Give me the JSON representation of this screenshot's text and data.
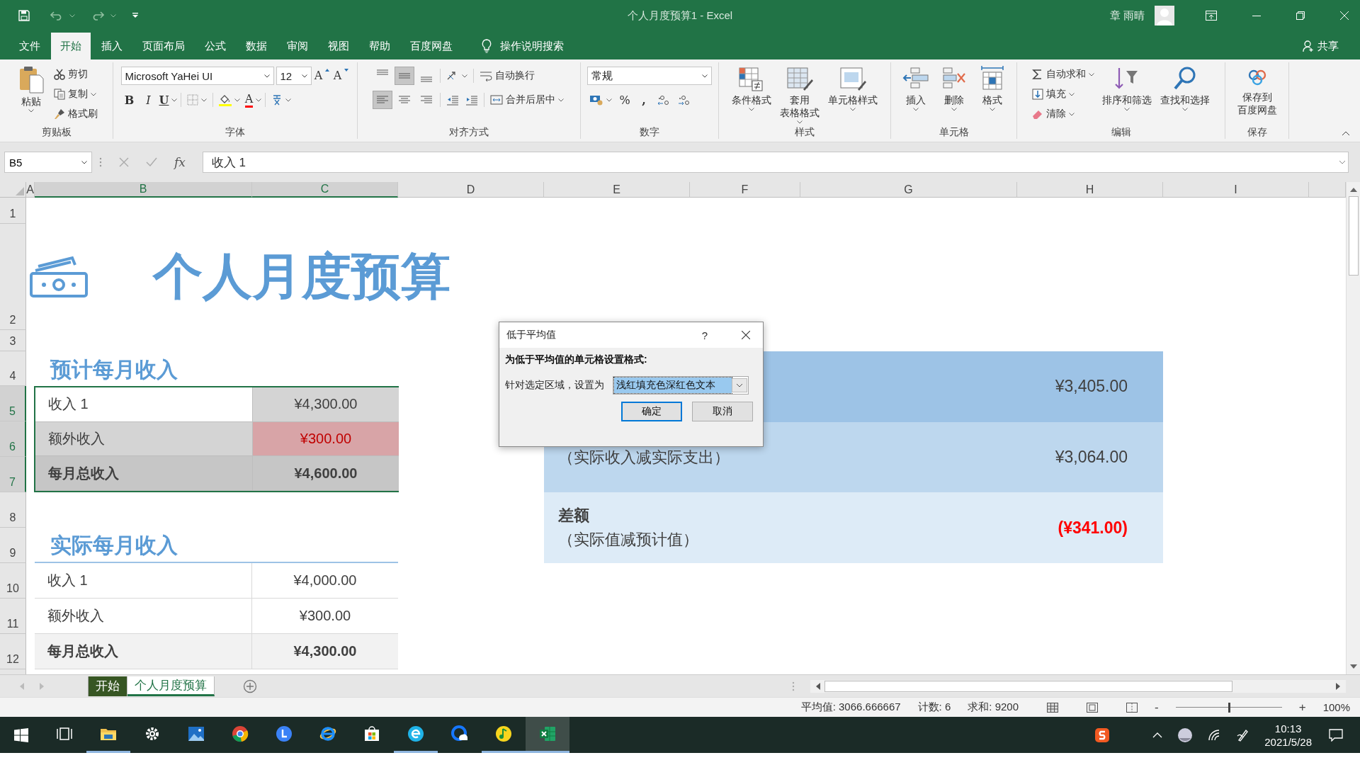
{
  "window": {
    "title": "个人月度预算1  -  Excel",
    "user": "章 雨晴"
  },
  "menu_tabs": [
    {
      "label": "文件",
      "selected": false
    },
    {
      "label": "开始",
      "selected": true
    },
    {
      "label": "插入",
      "selected": false
    },
    {
      "label": "页面布局",
      "selected": false
    },
    {
      "label": "公式",
      "selected": false
    },
    {
      "label": "数据",
      "selected": false
    },
    {
      "label": "审阅",
      "selected": false
    },
    {
      "label": "视图",
      "selected": false
    },
    {
      "label": "帮助",
      "selected": false
    },
    {
      "label": "百度网盘",
      "selected": false
    }
  ],
  "tell_me": "操作说明搜索",
  "share": "共享",
  "ribbon": {
    "clipboard": {
      "label": "剪贴板",
      "paste": "粘贴",
      "cut": "剪切",
      "copy": "复制",
      "format_painter": "格式刷"
    },
    "font": {
      "label": "字体",
      "font_name": "Microsoft YaHei UI",
      "font_size": "12",
      "grow": "A",
      "shrink": "A",
      "bold": "B",
      "italic": "I",
      "underline": "U",
      "font_color": "A"
    },
    "alignment": {
      "label": "对齐方式",
      "vertical": [
        {
          "selected": false
        },
        {
          "selected": true
        },
        {
          "selected": false
        }
      ],
      "horizontal": [
        {
          "selected": true
        },
        {
          "selected": false
        },
        {
          "selected": false
        }
      ],
      "wrap": "自动换行",
      "merge": "合并后居中"
    },
    "number": {
      "label": "数字",
      "format": "常规",
      "percent": "%",
      "comma": ","
    },
    "styles": {
      "label": "样式",
      "items": [
        [
          "条件格式"
        ],
        [
          "套用",
          "表格格式"
        ],
        [
          "单元格样式"
        ]
      ]
    },
    "cells": {
      "label": "单元格",
      "items": [
        "插入",
        "删除",
        "格式"
      ]
    },
    "editing": {
      "label": "编辑",
      "autosum": "自动求和",
      "fill": "填充",
      "clear": "清除",
      "sort": "排序和筛选",
      "find": "查找和选择"
    },
    "save": {
      "label": "保存",
      "button": [
        "保存到",
        "百度网盘"
      ]
    }
  },
  "formula_bar": {
    "name_box": "B5",
    "fx": "fx",
    "value": "收入 1"
  },
  "sheet": {
    "columns": [
      {
        "label": "A",
        "selected": false
      },
      {
        "label": "B",
        "selected": true
      },
      {
        "label": "C",
        "selected": true
      },
      {
        "label": "D",
        "selected": false
      },
      {
        "label": "E",
        "selected": false
      },
      {
        "label": "F",
        "selected": false
      },
      {
        "label": "G",
        "selected": false
      },
      {
        "label": "H",
        "selected": false
      },
      {
        "label": "I",
        "selected": false
      }
    ],
    "rows": [
      {
        "label": "1",
        "selected": false
      },
      {
        "label": "2",
        "selected": false
      },
      {
        "label": "3",
        "selected": false
      },
      {
        "label": "4",
        "selected": false
      },
      {
        "label": "5",
        "selected": true
      },
      {
        "label": "6",
        "selected": true
      },
      {
        "label": "7",
        "selected": true
      },
      {
        "label": "8",
        "selected": false
      },
      {
        "label": "9",
        "selected": false
      },
      {
        "label": "10",
        "selected": false
      },
      {
        "label": "11",
        "selected": false
      },
      {
        "label": "12",
        "selected": false
      }
    ],
    "title": "个人月度预算",
    "expected_income": {
      "heading": "预计每月收入",
      "selected": true,
      "rows": [
        {
          "kind": "item",
          "label": "收入 1",
          "value": "¥4,300.00",
          "active": true,
          "flagged": false
        },
        {
          "kind": "item",
          "label": "额外收入",
          "value": "¥300.00",
          "active": false,
          "flagged": true
        },
        {
          "kind": "total",
          "label": "每月总收入",
          "value": "¥4,600.00",
          "active": false,
          "flagged": false
        }
      ]
    },
    "actual_income": {
      "heading": "实际每月收入",
      "rows": [
        {
          "kind": "item",
          "label": "收入 1",
          "value": "¥4,000.00",
          "active": false,
          "flagged": false
        },
        {
          "kind": "item",
          "label": "额外收入",
          "value": "¥300.00",
          "active": false,
          "flagged": false
        },
        {
          "kind": "total",
          "label": "每月总收入",
          "value": "¥4,300.00",
          "active": false,
          "flagged": false
        }
      ]
    },
    "summary": [
      {
        "value": "¥3,405.00",
        "color": "#9dc3e6",
        "negative": false
      },
      {
        "note": "（实际收入减实际支出）",
        "value": "¥3,064.00",
        "color": "#bdd7ee",
        "negative": false
      },
      {
        "label": "差额",
        "note": "（实际值减预计值）",
        "value": "(¥341.00)",
        "color": "#ddebf7",
        "negative": true
      }
    ]
  },
  "dialog": {
    "title": "低于平均值",
    "help": "?",
    "prompt": "为低于平均值的单元格设置格式:",
    "label": "针对选定区域，设置为",
    "format": "浅红填充色深红色文本",
    "ok": "确定",
    "cancel": "取消"
  },
  "sheet_tabs": [
    {
      "label": "开始",
      "selected": false,
      "color": "#375623"
    },
    {
      "label": "个人月度预算",
      "selected": true
    }
  ],
  "status_bar": {
    "average": "平均值: 3066.666667",
    "count": "计数: 6",
    "sum": "求和: 9200",
    "zoom_out": "-",
    "zoom_in": "+",
    "zoom_slider": {
      "level": 0.5
    },
    "zoom": "100%"
  },
  "taskbar": {
    "apps": [
      {
        "kind": "taskview",
        "running": false,
        "active": false
      },
      {
        "kind": "explorer",
        "running": true,
        "active": false
      },
      {
        "kind": "settings",
        "running": false,
        "active": false
      },
      {
        "kind": "photos",
        "running": false,
        "active": false
      },
      {
        "kind": "chrome",
        "running": false,
        "active": false
      },
      {
        "kind": "circle_app",
        "running": false,
        "active": false
      },
      {
        "kind": "ie",
        "running": false,
        "active": false
      },
      {
        "kind": "store",
        "running": false,
        "active": false
      },
      {
        "kind": "edge",
        "running": true,
        "active": false
      },
      {
        "kind": "cloud",
        "running": false,
        "active": false
      },
      {
        "kind": "music",
        "running": true,
        "active": false
      },
      {
        "kind": "excel",
        "running": true,
        "active": true
      }
    ],
    "time": "10:13",
    "date": "2021/5/28"
  }
}
